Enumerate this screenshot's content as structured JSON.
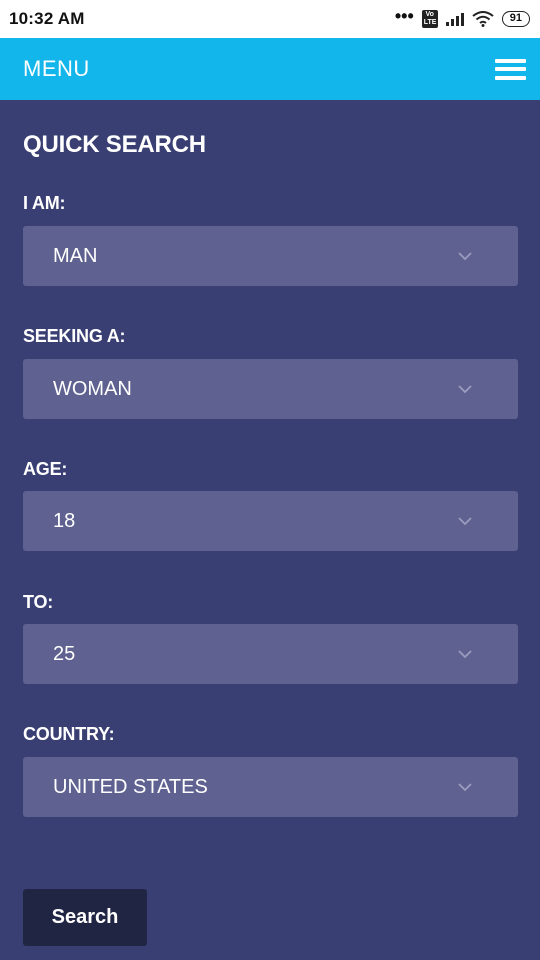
{
  "status_bar": {
    "time": "10:32 AM",
    "dots": "•••",
    "volte": "Vo LTE",
    "battery": "91"
  },
  "nav": {
    "menu_label": "MENU",
    "hamburger_icon": "hamburger-menu-icon"
  },
  "search": {
    "title": "QUICK SEARCH",
    "fields": [
      {
        "label": "I AM:",
        "value": "MAN"
      },
      {
        "label": "SEEKING A:",
        "value": "WOMAN"
      },
      {
        "label": "AGE:",
        "value": "18"
      },
      {
        "label": "TO:",
        "value": "25"
      },
      {
        "label": "COUNTRY:",
        "value": "UNITED STATES"
      }
    ],
    "button_label": "Search"
  },
  "colors": {
    "nav_bg": "#12b6ea",
    "page_bg": "#3a3f73",
    "select_bg": "#5f6290",
    "button_bg": "#212544"
  }
}
